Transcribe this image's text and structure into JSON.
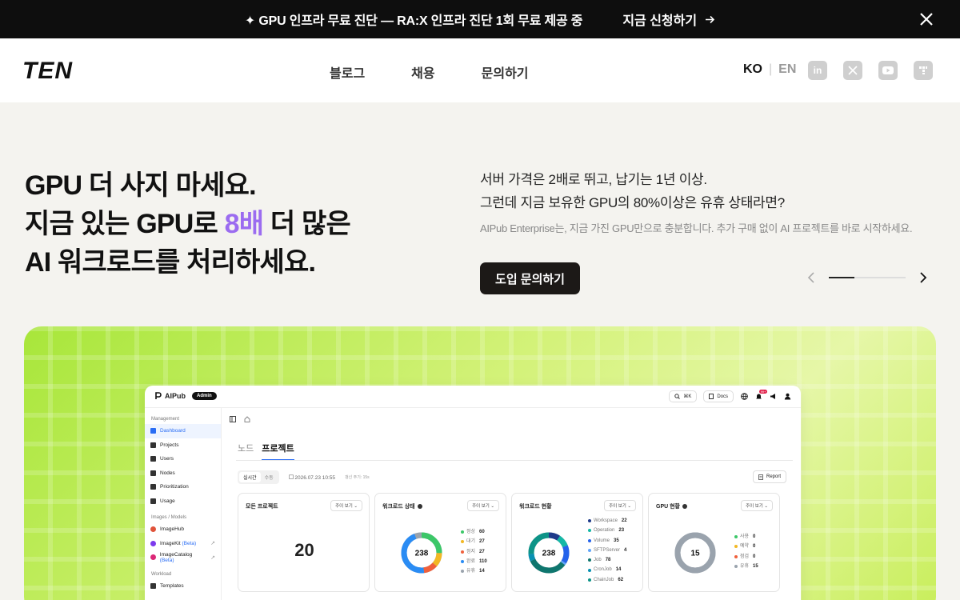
{
  "announcement": {
    "message": "✦ GPU 인프라 무료 진단 — RA:X 인프라 진단 1회 무료 제공 중",
    "cta": "지금 신청하기",
    "close_icon": "close-icon"
  },
  "header": {
    "logo": "TEN",
    "nav": [
      "블로그",
      "채용",
      "문의하기"
    ],
    "lang_active": "KO",
    "lang_sep": "|",
    "lang_other": "EN",
    "socials": [
      "linkedin-icon",
      "x-icon",
      "youtube-icon",
      "brand-icon"
    ]
  },
  "hero": {
    "title_line1": "GPU 더 사지 마세요.",
    "title_line2_pre": "지금 있는 GPU로 ",
    "title_line2_accent": "8배",
    "title_line2_post": " 더 많은",
    "title_line3": "AI 워크로드를 처리하세요.",
    "sub_line1": "서버 가격은 2배로 뛰고, 납기는 1년 이상.",
    "sub_line2": "그런데 지금 보유한 GPU의 80%이상은 유휴 상태라면?",
    "desc": "AIPub Enterprise는, 지금 가진 GPU만으로 충분합니다. 추가 구매 없이 AI 프로젝트를 바로 시작하세요.",
    "cta": "도입 문의하기",
    "carousel_progress": 0.33
  },
  "colors": {
    "accent": "#9b6cf0",
    "dark": "#1c1917",
    "panel_green": "#c8ee5a",
    "link_blue": "#2a6df4"
  },
  "dashboard": {
    "logo": "AIPub",
    "badge": "Admin",
    "search_shortcut": "⌘K",
    "docs": "Docs",
    "notif_count": "99+",
    "sidebar": {
      "group1": "Management",
      "items1": [
        "Dashboard",
        "Projects",
        "Users",
        "Nodes",
        "Prioritization",
        "Usage"
      ],
      "group2": "Images / Models",
      "image_hub": "ImageHub",
      "image_kit": "ImageKit",
      "image_kit_tag": "(Beta)",
      "image_catalog": "ImageCatalog",
      "image_catalog_tag": "(Beta)",
      "group3": "Workload",
      "templates": "Templates"
    },
    "tabs": [
      "노드",
      "프로젝트"
    ],
    "realtime": "실시간",
    "manual": "수동",
    "date": "2026.07.23 10:55",
    "updated": "갱신 주기: 15s",
    "report": "Report",
    "dropdown": "주이 보기",
    "cards": {
      "projects": {
        "title": "모든 프로젝트",
        "value": "20"
      },
      "workload_status": {
        "title": "워크로드 상태",
        "total": "238",
        "items": [
          {
            "label": "정상",
            "value": 60,
            "color": "#3cc768"
          },
          {
            "label": "대기",
            "value": 27,
            "color": "#f2b824"
          },
          {
            "label": "정지",
            "value": 27,
            "color": "#f0603c"
          },
          {
            "label": "완료",
            "value": 110,
            "color": "#2a8cf4"
          },
          {
            "label": "유휴",
            "value": 14,
            "color": "#9aa3ad"
          }
        ]
      },
      "workload_types": {
        "title": "워크로드 현황",
        "total": "238",
        "items": [
          {
            "label": "Workspace",
            "value": 22,
            "color": "#1e3a8a"
          },
          {
            "label": "Operation",
            "value": 23,
            "color": "#14b8a6"
          },
          {
            "label": "Volume",
            "value": 35,
            "color": "#2563eb"
          },
          {
            "label": "SFTPServer",
            "value": 4,
            "color": "#60a5fa"
          },
          {
            "label": "Job",
            "value": 78,
            "color": "#0f766e"
          },
          {
            "label": "CronJob",
            "value": 14,
            "color": "#0891b2"
          },
          {
            "label": "ChainJob",
            "value": 62,
            "color": "#0d9488"
          }
        ]
      },
      "gpu_status": {
        "title": "GPU 현황",
        "total": "15",
        "items": [
          {
            "label": "사용",
            "value": 0,
            "color": "#3cc768"
          },
          {
            "label": "예약",
            "value": 0,
            "color": "#f2b824"
          },
          {
            "label": "점검",
            "value": 0,
            "color": "#f0603c"
          },
          {
            "label": "유휴",
            "value": 15,
            "color": "#9aa3ad"
          }
        ]
      }
    }
  }
}
